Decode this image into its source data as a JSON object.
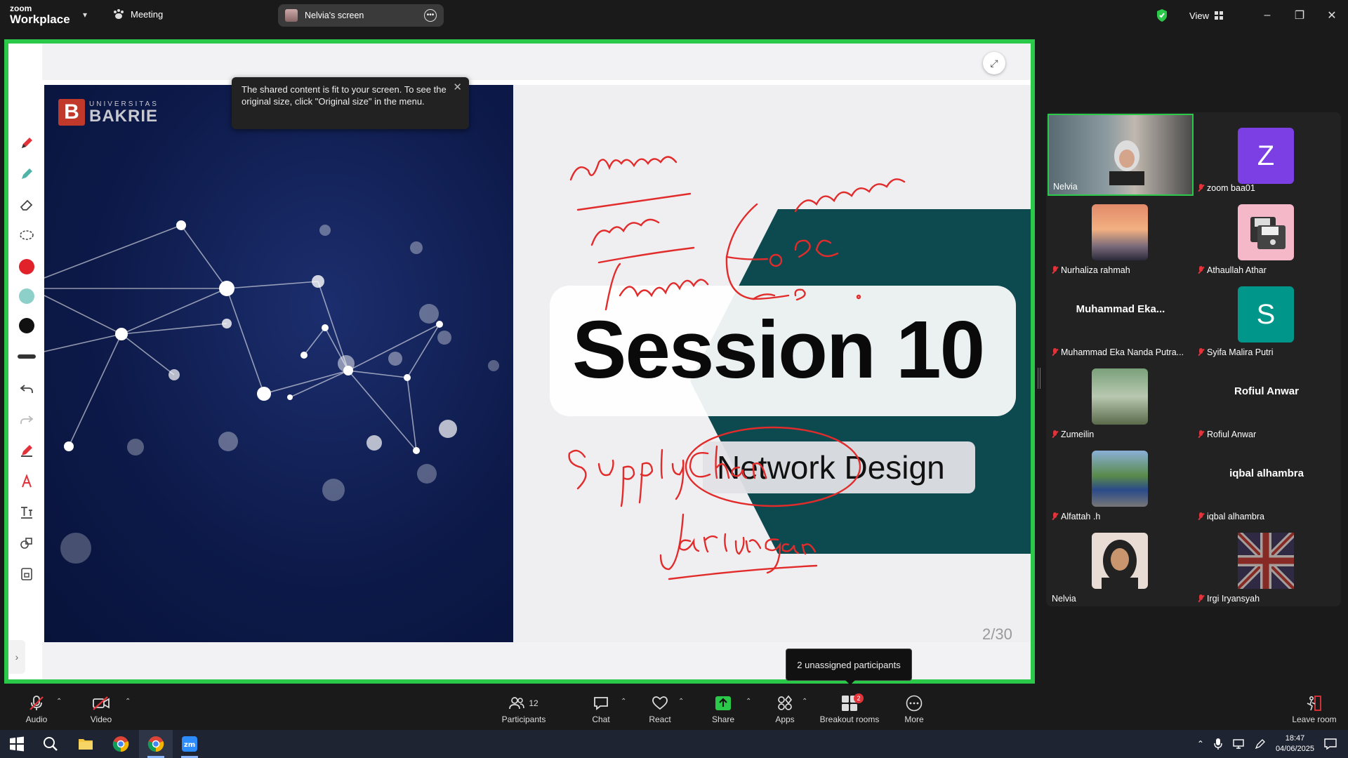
{
  "app": {
    "brand_small": "zoom",
    "brand_large": "Workplace",
    "meeting_label": "Meeting",
    "shared_screen_label": "Nelvia's screen",
    "view_label": "View"
  },
  "tooltip": {
    "text": "The shared content is fit to your screen. To see the original size, click \"Original size\" in the menu."
  },
  "slide": {
    "brand_line1": "UNIVERSITAS",
    "brand_line2": "BAKRIE",
    "brand_mark": "B",
    "title": "Session 10",
    "subtitle": "Network Design",
    "page": "2/30",
    "annotations": [
      "Suppliers",
      "pabrik",
      "distributor",
      "warehouse",
      "DC",
      "D",
      "Supply Chain",
      "Jaringan"
    ]
  },
  "participants": [
    {
      "name": "Nelvia",
      "muted": false,
      "type": "photo",
      "active": true
    },
    {
      "name": "zoom baa01",
      "muted": true,
      "type": "letter",
      "letter": "Z",
      "color": "#7b3fe4"
    },
    {
      "name": "Nurhaliza rahmah",
      "muted": true,
      "type": "photo"
    },
    {
      "name": "Athaullah Athar",
      "muted": true,
      "type": "photo"
    },
    {
      "name": "Muhammad Eka Nanda Putra...",
      "display": "Muhammad  Eka...",
      "muted": true,
      "type": "text"
    },
    {
      "name": "Syifa Malira Putri",
      "muted": true,
      "type": "letter",
      "letter": "S",
      "color": "#00968a"
    },
    {
      "name": "Zumeilin",
      "muted": true,
      "type": "photo"
    },
    {
      "name": "Rofiul Anwar",
      "display": "Rofiul Anwar",
      "muted": true,
      "type": "text"
    },
    {
      "name": "Alfattah .h",
      "muted": true,
      "type": "photo"
    },
    {
      "name": "iqbal alhambra",
      "display": "iqbal alhambra",
      "muted": true,
      "type": "text"
    },
    {
      "name": "Nelvia",
      "muted": false,
      "type": "photo"
    },
    {
      "name": "Irgi Iryansyah",
      "muted": true,
      "type": "photo"
    }
  ],
  "unassigned_tooltip": "2 unassigned participants",
  "controls": {
    "audio": "Audio",
    "video": "Video",
    "participants": "Participants",
    "participants_count": "12",
    "chat": "Chat",
    "react": "React",
    "share": "Share",
    "apps": "Apps",
    "breakout": "Breakout rooms",
    "breakout_badge": "2",
    "more": "More",
    "leave": "Leave room"
  },
  "taskbar": {
    "time": "18:47",
    "date": "04/06/2025"
  }
}
